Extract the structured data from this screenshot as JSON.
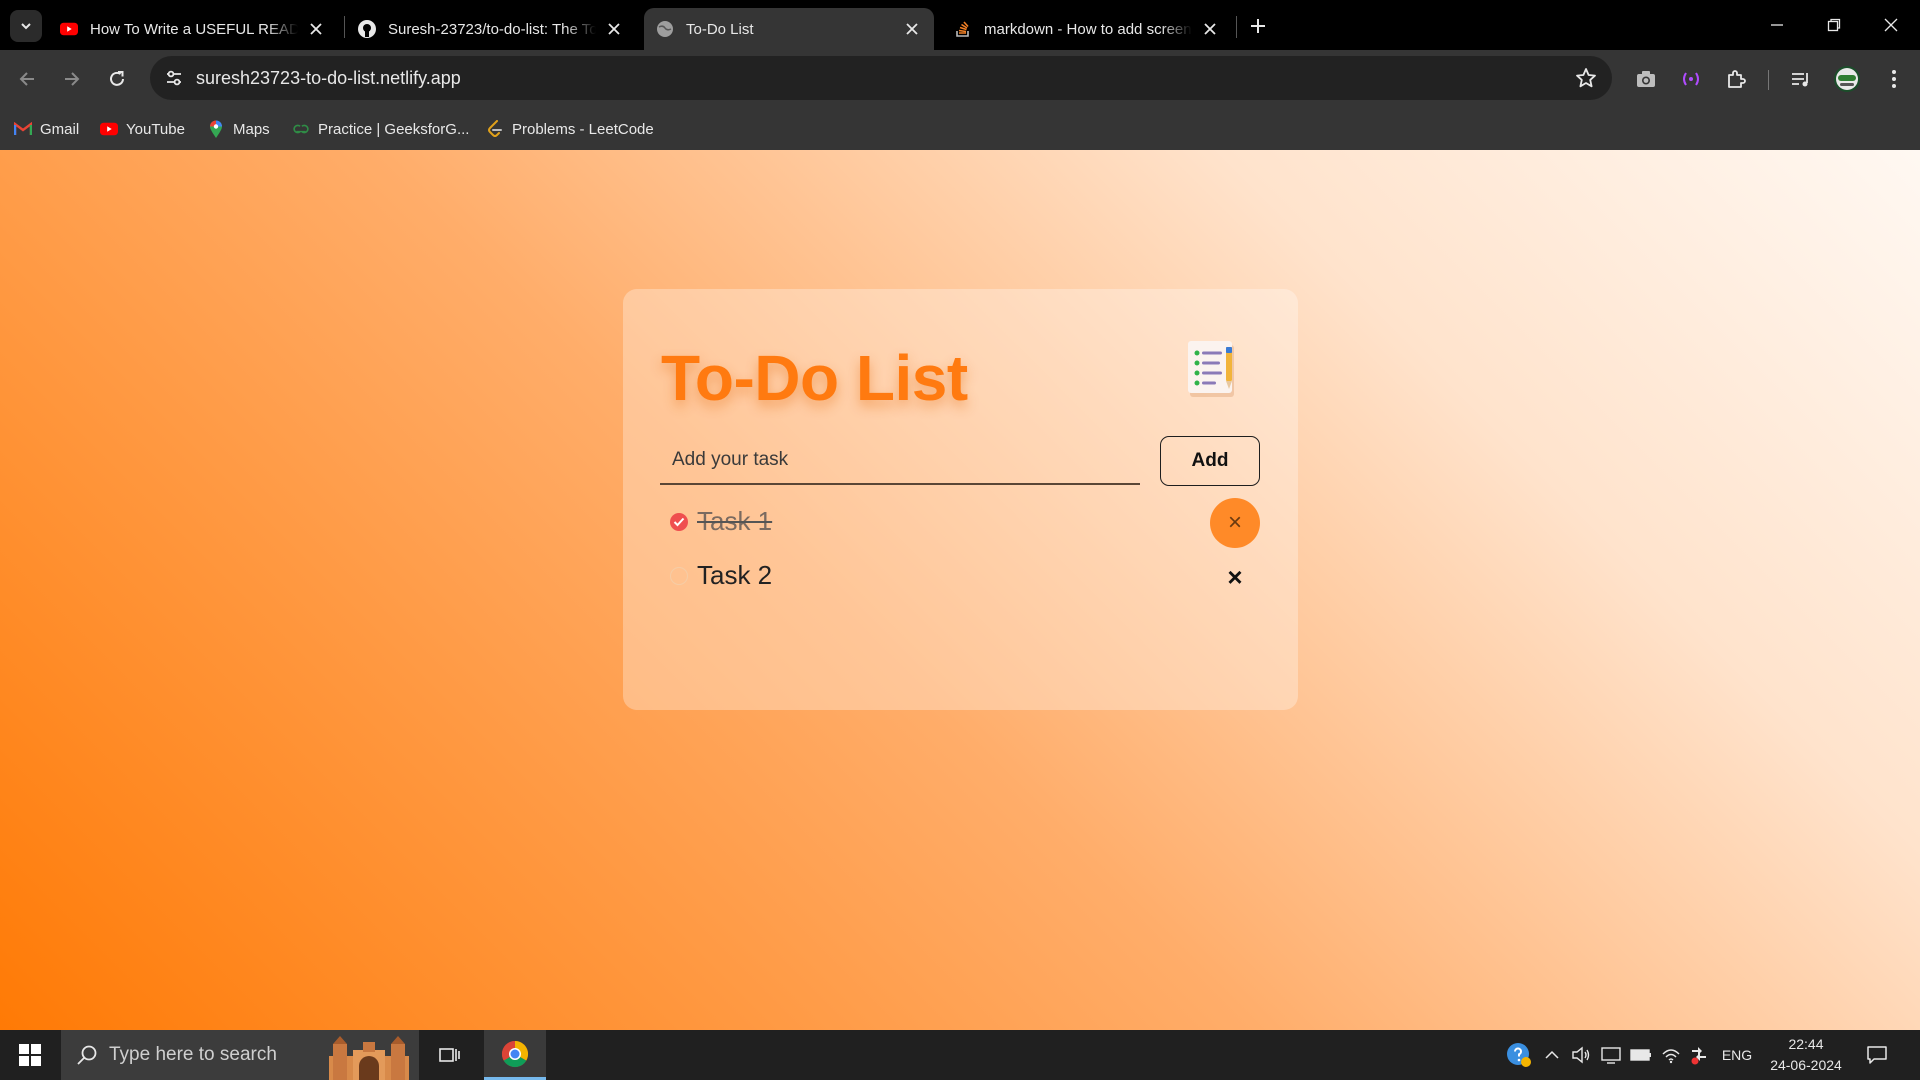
{
  "browser": {
    "tabs": [
      {
        "title": "How To Write a USEFUL READM",
        "favicon": "youtube-icon",
        "active": false
      },
      {
        "title": "Suresh-23723/to-do-list: The To",
        "favicon": "github-icon",
        "active": false
      },
      {
        "title": "To-Do List",
        "favicon": "globe-icon",
        "active": true
      },
      {
        "title": "markdown - How to add screen",
        "favicon": "stackoverflow-icon",
        "active": false
      }
    ],
    "url": "suresh23723-to-do-list.netlify.app",
    "bookmarks": [
      {
        "label": "Gmail",
        "icon": "gmail-icon"
      },
      {
        "label": "YouTube",
        "icon": "youtube-icon"
      },
      {
        "label": "Maps",
        "icon": "maps-icon"
      },
      {
        "label": "Practice | GeeksforG...",
        "icon": "geeksforgeeks-icon"
      },
      {
        "label": "Problems - LeetCode",
        "icon": "leetcode-icon"
      }
    ]
  },
  "app": {
    "title": "To-Do List",
    "input_placeholder": "Add your task",
    "input_value": "",
    "add_label": "Add",
    "tasks": [
      {
        "text": "Task 1",
        "completed": true
      },
      {
        "text": "Task 2",
        "completed": false
      }
    ],
    "delete_glyph": "×",
    "colors": {
      "title": "#ff7a10",
      "check_done": "#ef4f4f",
      "delete_hover": "#ff8a28"
    }
  },
  "taskbar": {
    "search_placeholder": "Type here to search",
    "language": "ENG",
    "time": "22:44",
    "date": "24-06-2024"
  }
}
